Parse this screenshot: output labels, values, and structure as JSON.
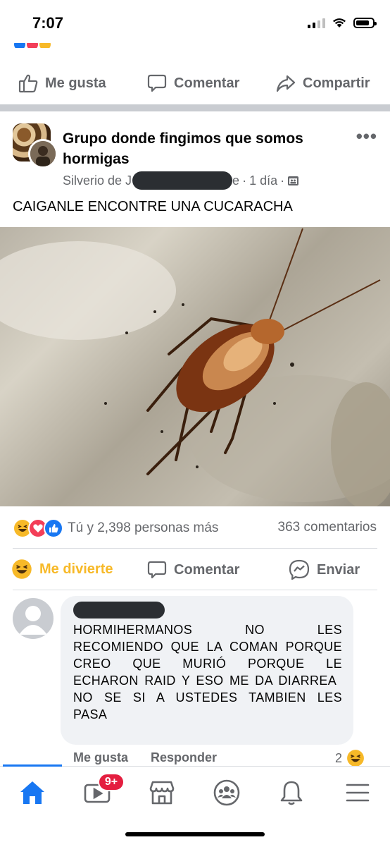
{
  "status_bar": {
    "time": "7:07"
  },
  "previous_post": {
    "actions": {
      "like": "Me gusta",
      "comment": "Comentar",
      "share": "Compartir"
    }
  },
  "post": {
    "group_name": "Grupo donde fingimos que somos hormigas",
    "author_prefix": "Silverio de J",
    "author_suffix": "e",
    "time": "1 día",
    "text": "CAIGANLE ENCONTRE UNA CUCARACHA",
    "reactions_text": "Tú y 2,398 personas más",
    "comments_count": "363 comentarios",
    "actions": {
      "react": "Me divierte",
      "comment": "Comentar",
      "send": "Enviar"
    }
  },
  "comment": {
    "text": "HORMIHERMANOS NO LES RECOMIENDO QUE LA COMAN PORQUE CREO QUE MURIÓ PORQUE LE ECHARON RAID Y ESO ME DA DIARREA\nNO SE SI A USTEDES TAMBIEN LES PASA",
    "like": "Me gusta",
    "reply": "Responder",
    "reaction_count": "2"
  },
  "nav": {
    "video_badge": "9+",
    "icons": [
      "home-icon",
      "video-icon",
      "marketplace-icon",
      "groups-icon",
      "notifications-icon",
      "menu-icon"
    ]
  },
  "colors": {
    "accent": "#1877f2",
    "reaction_active": "#f7b928",
    "secondary_text": "#65676b",
    "badge": "#e41e3f"
  }
}
